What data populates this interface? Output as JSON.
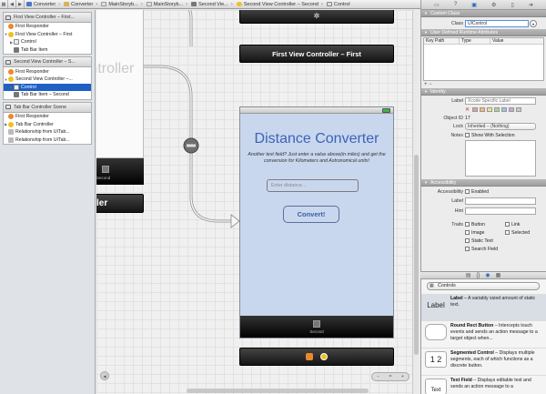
{
  "jumpbar": {
    "crumbs": [
      "Converter",
      "Converter",
      "MainStoryb...",
      "MainStoryb...",
      "Second Vie...",
      "Second View Controller – Second",
      "Control"
    ]
  },
  "outline": {
    "scenes": [
      {
        "title": "First View Controller – First...",
        "rows": [
          "First Responder",
          "First View Controller – First",
          "Control",
          "Tab Bar Item"
        ]
      },
      {
        "title": "Second View Controller – S...",
        "rows": [
          "First Responder",
          "Second View Controller –...",
          "Control",
          "Tab Bar Item – Second"
        ]
      },
      {
        "title": "Tab Bar Controller Scene",
        "rows": [
          "First Responder",
          "Tab Bar Controller",
          "Relationship from UITab...",
          "Relationship from UITab..."
        ]
      }
    ]
  },
  "canvas": {
    "left_scene_title": "Controller",
    "left_scene_bar_label": "ler",
    "left_tab_label": "Second",
    "first_vc_bar": "First View Controller – First",
    "title": "Distance Converter",
    "description": "Another text field? Just enter a value above(in miles) and get the conversion for Kilometers and Astronomical units!",
    "input_placeholder": "Enter distance...",
    "convert_button": "Convert!",
    "tab_label": "Second"
  },
  "inspector": {
    "custom_class": {
      "header": "Custom Class",
      "class_label": "Class",
      "class_value": "UIControl"
    },
    "runtime_attributes": {
      "header": "User Defined Runtime Attributes",
      "columns": [
        "Key Path",
        "Type",
        "Value"
      ]
    },
    "identity": {
      "header": "Identity",
      "label_label": "Label",
      "label_placeholder": "Xcode Specific Label",
      "object_id_label": "Object ID",
      "object_id_value": "17",
      "lock_label": "Lock",
      "lock_value": "Inherited – (Nothing)",
      "notes_label": "Notes",
      "show_with_selection": "Show With Selection",
      "color_swatches": [
        "#e0a0a0",
        "#f0b87a",
        "#efe48a",
        "#a8d88a",
        "#9cc0ec",
        "#c8a8e0",
        "#c8c8c8"
      ]
    },
    "accessibility": {
      "header": "Accessibility",
      "accessibility_label": "Accessibility",
      "enabled_label": "Enabled",
      "label_label": "Label",
      "hint_label": "Hint",
      "traits_label": "Traits",
      "traits": [
        "Button",
        "Link",
        "Image",
        "Selected",
        "Static Text",
        "Search Field"
      ]
    }
  },
  "library": {
    "dropdown": "Controls",
    "items": [
      {
        "icon_text": "Label",
        "name": "Label",
        "desc": " – A variably sized amount of static text."
      },
      {
        "icon_text": "",
        "name": "Round Rect Button",
        "desc": " – Intercepts touch events and sends an action message to a target object when..."
      },
      {
        "icon_text": "1 2",
        "name": "Segmented Control",
        "desc": " – Displays multiple segments, each of which functions as a discrete button."
      },
      {
        "icon_text": "Text",
        "name": "Text Field",
        "desc": " – Displays editable text and sends an action message to a"
      }
    ]
  }
}
